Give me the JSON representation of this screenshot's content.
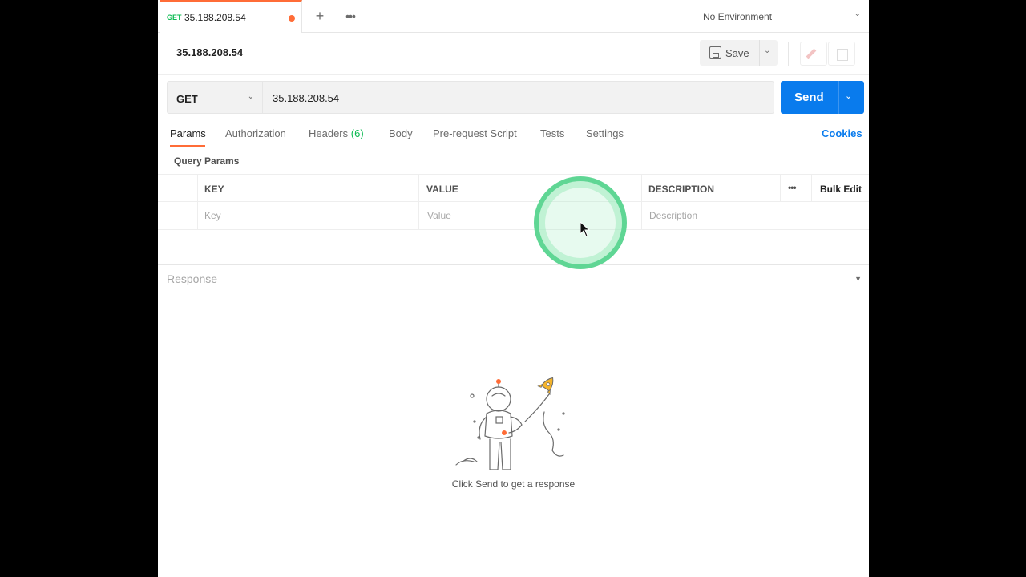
{
  "tab": {
    "method": "GET",
    "name": "35.188.208.54"
  },
  "environment": {
    "label": "No Environment"
  },
  "request": {
    "title": "35.188.208.54",
    "method": "GET",
    "url": "35.188.208.54"
  },
  "toolbar": {
    "save_label": "Save",
    "send_label": "Send"
  },
  "request_tabs": [
    {
      "label": "Params"
    },
    {
      "label": "Authorization"
    },
    {
      "label": "Headers",
      "count": "(6)"
    },
    {
      "label": "Body"
    },
    {
      "label": "Pre-request Script"
    },
    {
      "label": "Tests"
    },
    {
      "label": "Settings"
    }
  ],
  "cookies_label": "Cookies",
  "query_params": {
    "title": "Query Params",
    "headers": {
      "key": "KEY",
      "value": "VALUE",
      "description": "DESCRIPTION",
      "bulk_edit": "Bulk Edit"
    },
    "placeholders": {
      "key": "Key",
      "value": "Value",
      "description": "Description"
    }
  },
  "response": {
    "title": "Response",
    "empty_message": "Click Send to get a response"
  },
  "colors": {
    "accent_orange": "#ff6c37",
    "send_blue": "#097bed",
    "method_green": "#0cbb52",
    "click_ring": "#5fd694"
  },
  "icons": [
    "plus-icon",
    "more-icon",
    "chevron-down-icon",
    "save-icon",
    "edit-icon",
    "documentation-icon",
    "cursor-icon"
  ]
}
